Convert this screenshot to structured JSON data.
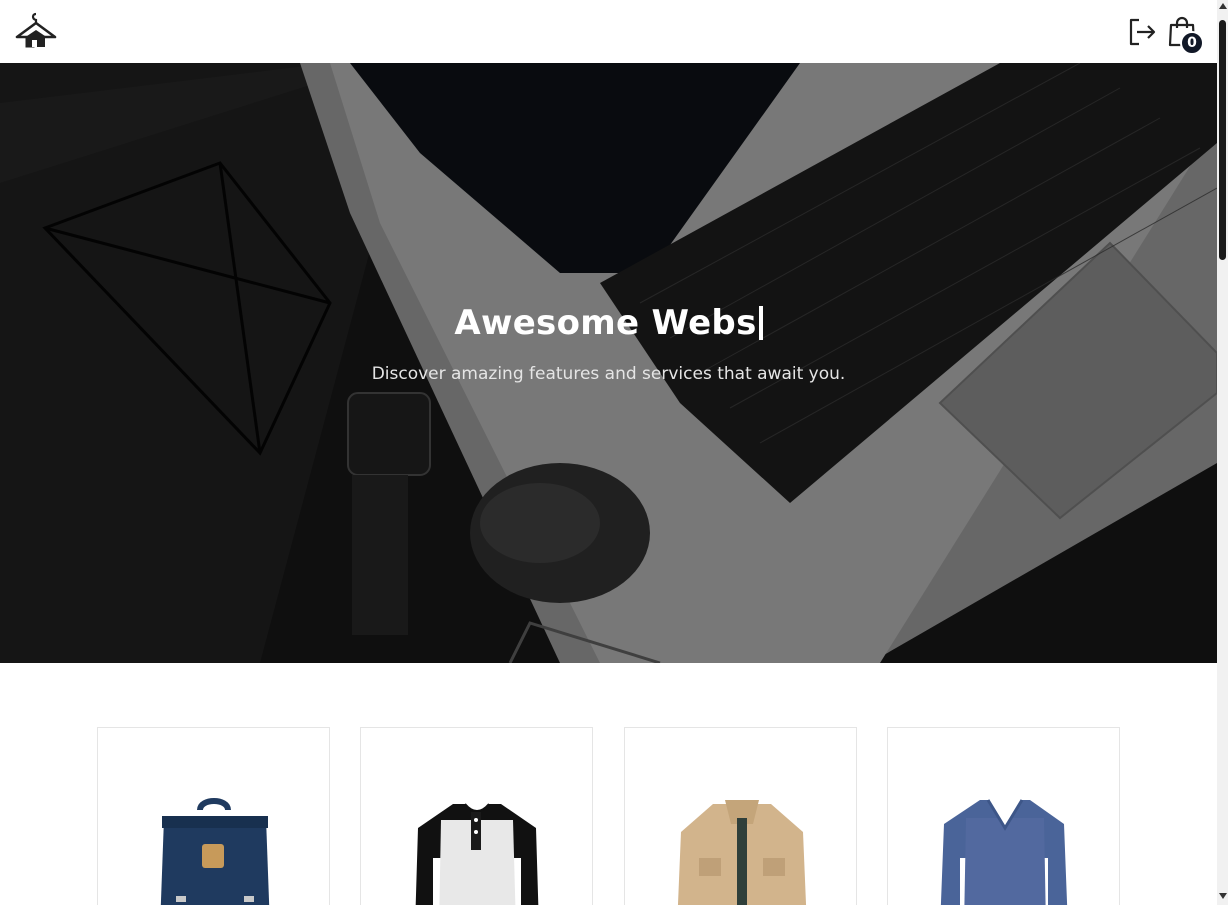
{
  "header": {
    "logo_icon": "hanger-home-icon",
    "logout_icon": "logout-icon",
    "cart_icon": "shopping-bag-icon",
    "cart_count": "0"
  },
  "hero": {
    "title": "Awesome Webs",
    "subtitle": "Discover amazing features and services that await you."
  },
  "products": {
    "items": [
      {
        "icon": "backpack-image",
        "color": "#1f3a5f"
      },
      {
        "icon": "henley-shirt-image",
        "color": "#111111"
      },
      {
        "icon": "jacket-image",
        "color": "#d2b48c"
      },
      {
        "icon": "sweater-image",
        "color": "#4a6499"
      }
    ]
  },
  "colors": {
    "brand": "#111827",
    "hero_bg": "#121212"
  }
}
